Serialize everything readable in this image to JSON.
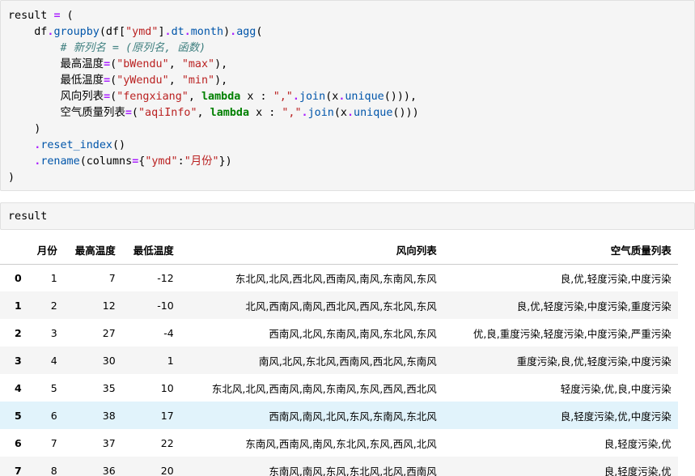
{
  "code_cell": {
    "lines": [
      [
        {
          "t": "result ",
          "c": "nm"
        },
        {
          "t": "=",
          "c": "op"
        },
        {
          "t": " (",
          "c": "nm"
        }
      ],
      [
        {
          "t": "    df",
          "c": "nm"
        },
        {
          "t": ".",
          "c": "op"
        },
        {
          "t": "groupby",
          "c": "attr"
        },
        {
          "t": "(df[",
          "c": "nm"
        },
        {
          "t": "\"ymd\"",
          "c": "str"
        },
        {
          "t": "]",
          "c": "nm"
        },
        {
          "t": ".",
          "c": "op"
        },
        {
          "t": "dt",
          "c": "attr"
        },
        {
          "t": ".",
          "c": "op"
        },
        {
          "t": "month",
          "c": "attr"
        },
        {
          "t": ")",
          "c": "nm"
        },
        {
          "t": ".",
          "c": "op"
        },
        {
          "t": "agg",
          "c": "attr"
        },
        {
          "t": "(",
          "c": "nm"
        }
      ],
      [
        {
          "t": "        ",
          "c": "nm"
        },
        {
          "t": "# 新列名 = (原列名, 函数)",
          "c": "cm"
        }
      ],
      [
        {
          "t": "        最高温度",
          "c": "nm"
        },
        {
          "t": "=",
          "c": "op"
        },
        {
          "t": "(",
          "c": "nm"
        },
        {
          "t": "\"bWendu\"",
          "c": "str"
        },
        {
          "t": ", ",
          "c": "nm"
        },
        {
          "t": "\"max\"",
          "c": "str"
        },
        {
          "t": "),",
          "c": "nm"
        }
      ],
      [
        {
          "t": "        最低温度",
          "c": "nm"
        },
        {
          "t": "=",
          "c": "op"
        },
        {
          "t": "(",
          "c": "nm"
        },
        {
          "t": "\"yWendu\"",
          "c": "str"
        },
        {
          "t": ", ",
          "c": "nm"
        },
        {
          "t": "\"min\"",
          "c": "str"
        },
        {
          "t": "),",
          "c": "nm"
        }
      ],
      [
        {
          "t": "        风向列表",
          "c": "nm"
        },
        {
          "t": "=",
          "c": "op"
        },
        {
          "t": "(",
          "c": "nm"
        },
        {
          "t": "\"fengxiang\"",
          "c": "str"
        },
        {
          "t": ", ",
          "c": "nm"
        },
        {
          "t": "lambda",
          "c": "kw"
        },
        {
          "t": " x : ",
          "c": "nm"
        },
        {
          "t": "\",\"",
          "c": "str"
        },
        {
          "t": ".",
          "c": "op"
        },
        {
          "t": "join",
          "c": "attr"
        },
        {
          "t": "(x",
          "c": "nm"
        },
        {
          "t": ".",
          "c": "op"
        },
        {
          "t": "unique",
          "c": "attr"
        },
        {
          "t": "())),",
          "c": "nm"
        }
      ],
      [
        {
          "t": "        空气质量列表",
          "c": "nm"
        },
        {
          "t": "=",
          "c": "op"
        },
        {
          "t": "(",
          "c": "nm"
        },
        {
          "t": "\"aqiInfo\"",
          "c": "str"
        },
        {
          "t": ", ",
          "c": "nm"
        },
        {
          "t": "lambda",
          "c": "kw"
        },
        {
          "t": " x : ",
          "c": "nm"
        },
        {
          "t": "\",\"",
          "c": "str"
        },
        {
          "t": ".",
          "c": "op"
        },
        {
          "t": "join",
          "c": "attr"
        },
        {
          "t": "(x",
          "c": "nm"
        },
        {
          "t": ".",
          "c": "op"
        },
        {
          "t": "unique",
          "c": "attr"
        },
        {
          "t": "()))",
          "c": "nm"
        }
      ],
      [
        {
          "t": "    )",
          "c": "nm"
        }
      ],
      [
        {
          "t": "    ",
          "c": "nm"
        },
        {
          "t": ".",
          "c": "op"
        },
        {
          "t": "reset_index",
          "c": "attr"
        },
        {
          "t": "()",
          "c": "nm"
        }
      ],
      [
        {
          "t": "    ",
          "c": "nm"
        },
        {
          "t": ".",
          "c": "op"
        },
        {
          "t": "rename",
          "c": "attr"
        },
        {
          "t": "(columns",
          "c": "nm"
        },
        {
          "t": "=",
          "c": "op"
        },
        {
          "t": "{",
          "c": "nm"
        },
        {
          "t": "\"ymd\"",
          "c": "str"
        },
        {
          "t": ":",
          "c": "nm"
        },
        {
          "t": "\"月份\"",
          "c": "str"
        },
        {
          "t": "})",
          "c": "nm"
        }
      ],
      [
        {
          "t": ")",
          "c": "nm"
        }
      ]
    ]
  },
  "input_cell": {
    "text": "result"
  },
  "dataframe": {
    "columns": [
      "",
      "月份",
      "最高温度",
      "最低温度",
      "风向列表",
      "空气质量列表"
    ],
    "rows": [
      {
        "index": "0",
        "month": "1",
        "max": "7",
        "min": "-12",
        "wind": "东北风,北风,西北风,西南风,南风,东南风,东风",
        "aqi": "良,优,轻度污染,中度污染"
      },
      {
        "index": "1",
        "month": "2",
        "max": "12",
        "min": "-10",
        "wind": "北风,西南风,南风,西北风,西风,东北风,东风",
        "aqi": "良,优,轻度污染,中度污染,重度污染"
      },
      {
        "index": "2",
        "month": "3",
        "max": "27",
        "min": "-4",
        "wind": "西南风,北风,东南风,南风,东北风,东风",
        "aqi": "优,良,重度污染,轻度污染,中度污染,严重污染"
      },
      {
        "index": "3",
        "month": "4",
        "max": "30",
        "min": "1",
        "wind": "南风,北风,东北风,西南风,西北风,东南风",
        "aqi": "重度污染,良,优,轻度污染,中度污染"
      },
      {
        "index": "4",
        "month": "5",
        "max": "35",
        "min": "10",
        "wind": "东北风,北风,西南风,南风,东南风,东风,西风,西北风",
        "aqi": "轻度污染,优,良,中度污染"
      },
      {
        "index": "5",
        "month": "6",
        "max": "38",
        "min": "17",
        "wind": "西南风,南风,北风,东风,东南风,东北风",
        "aqi": "良,轻度污染,优,中度污染"
      },
      {
        "index": "6",
        "month": "7",
        "max": "37",
        "min": "22",
        "wind": "东南风,西南风,南风,东北风,东风,西风,北风",
        "aqi": "良,轻度污染,优"
      },
      {
        "index": "7",
        "month": "8",
        "max": "36",
        "min": "20",
        "wind": "东南风,南风,东风,东北风,北风,西南风",
        "aqi": "良,轻度污染,优"
      }
    ],
    "hover_row_color": "#e1f3fb",
    "stripe_color": "#f5f5f5"
  }
}
